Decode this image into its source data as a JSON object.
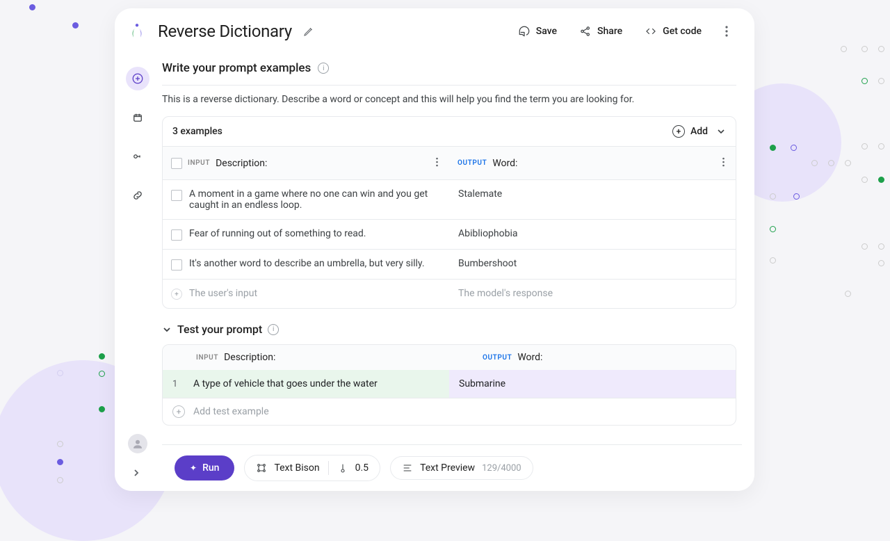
{
  "header": {
    "title": "Reverse Dictionary",
    "save": "Save",
    "share": "Share",
    "get_code": "Get code"
  },
  "prompt": {
    "heading": "Write your prompt examples",
    "description": "This is a reverse dictionary. Describe a word or concept and this will help you find the term you are looking for.",
    "examples_count": "3 examples",
    "add_label": "Add",
    "input_tag": "INPUT",
    "output_tag": "OUTPUT",
    "input_col": "Description:",
    "output_col": "Word:",
    "examples": [
      {
        "input": "A moment in a game where no one can win and you get caught in an endless loop.",
        "output": "Stalemate"
      },
      {
        "input": "Fear of running out of something to read.",
        "output": "Abibliophobia"
      },
      {
        "input": "It's another word to describe an umbrella, but very silly.",
        "output": "Bumbershoot"
      }
    ],
    "placeholder_input": "The user's input",
    "placeholder_output": "The model's response"
  },
  "test": {
    "heading": "Test your prompt",
    "rows": [
      {
        "num": "1",
        "input": "A type of vehicle that goes under the water",
        "output": "Submarine"
      }
    ],
    "add_label": "Add test example"
  },
  "footer": {
    "run": "Run",
    "model": "Text Bison",
    "temperature": "0.5",
    "preview": "Text Preview",
    "tokens": "129/4000"
  }
}
